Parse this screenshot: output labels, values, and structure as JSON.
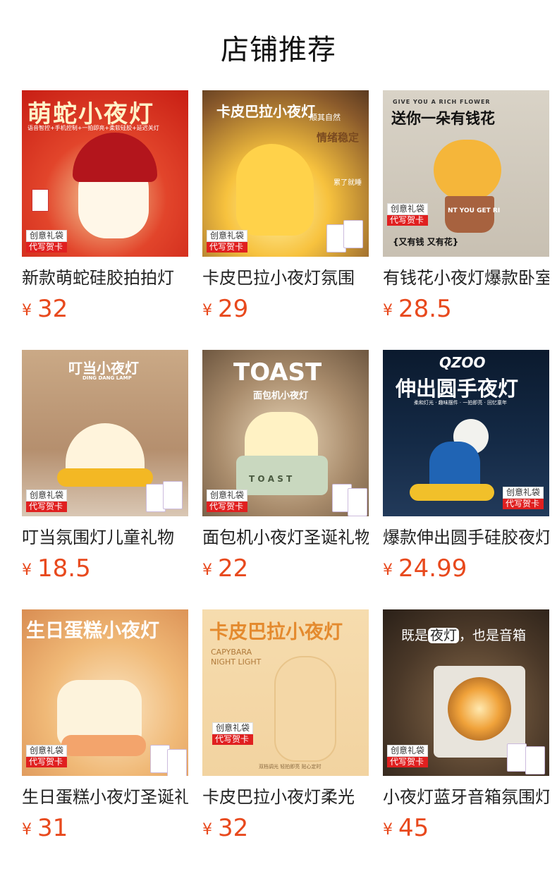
{
  "page": {
    "title": "店铺推荐"
  },
  "tags": {
    "line1": "创意礼袋",
    "line2": "代写贺卡"
  },
  "products": [
    {
      "name": "新款萌蛇硅胶拍拍灯",
      "currency": "¥",
      "price": "32",
      "image": {
        "headline": "萌蛇小夜灯",
        "subline": "语音智控+手机控制+一拍即亮+柔软硅胶+延迟关灯"
      }
    },
    {
      "name": "卡皮巴拉小夜灯氛围",
      "currency": "¥",
      "price": "29",
      "image": {
        "headline": "卡皮巴拉小夜灯",
        "sub1": "顺其自然",
        "sub2": "情绪稳定",
        "sub3": "累了就睡"
      }
    },
    {
      "name": "有钱花小夜灯爆款卧室",
      "currency": "¥",
      "price": "28.5",
      "image": {
        "top": "GIVE YOU A RICH FLOWER",
        "headline": "送你一朵有钱花",
        "pot": "NT YOU GET RI",
        "bottom": "{又有钱 又有花}"
      }
    },
    {
      "name": "叮当氛围灯儿童礼物",
      "currency": "¥",
      "price": "18.5",
      "image": {
        "headline": "叮当小夜灯",
        "subline": "DING DANG LAMP"
      }
    },
    {
      "name": "面包机小夜灯圣诞礼物",
      "currency": "¥",
      "price": "22",
      "image": {
        "headline": "TOAST",
        "subline": "面包机小夜灯",
        "body": "T O A S T"
      }
    },
    {
      "name": "爆款伸出圆手硅胶夜灯",
      "currency": "¥",
      "price": "24.99",
      "image": {
        "brand": "QZOO",
        "headline": "伸出圆手夜灯",
        "subline": "柔和灯光 · 趣味摆件 · 一拍即亮 · 回忆童年"
      }
    },
    {
      "name": "生日蛋糕小夜灯圣诞礼物",
      "currency": "¥",
      "price": "31",
      "image": {
        "headline": "生日蛋糕小夜灯"
      }
    },
    {
      "name": "卡皮巴拉小夜灯柔光",
      "currency": "¥",
      "price": "32",
      "image": {
        "headline": "卡皮巴拉小夜灯",
        "en1": "CAPYBARA",
        "en2": "NIGHT LIGHT",
        "bottom": "双档调光 轻拍即亮 贴心定时"
      }
    },
    {
      "name": "小夜灯蓝牙音箱氛围灯",
      "currency": "¥",
      "price": "45",
      "image": {
        "pre": "既是",
        "highlight": "夜灯",
        "post": "，也是音箱"
      }
    }
  ]
}
